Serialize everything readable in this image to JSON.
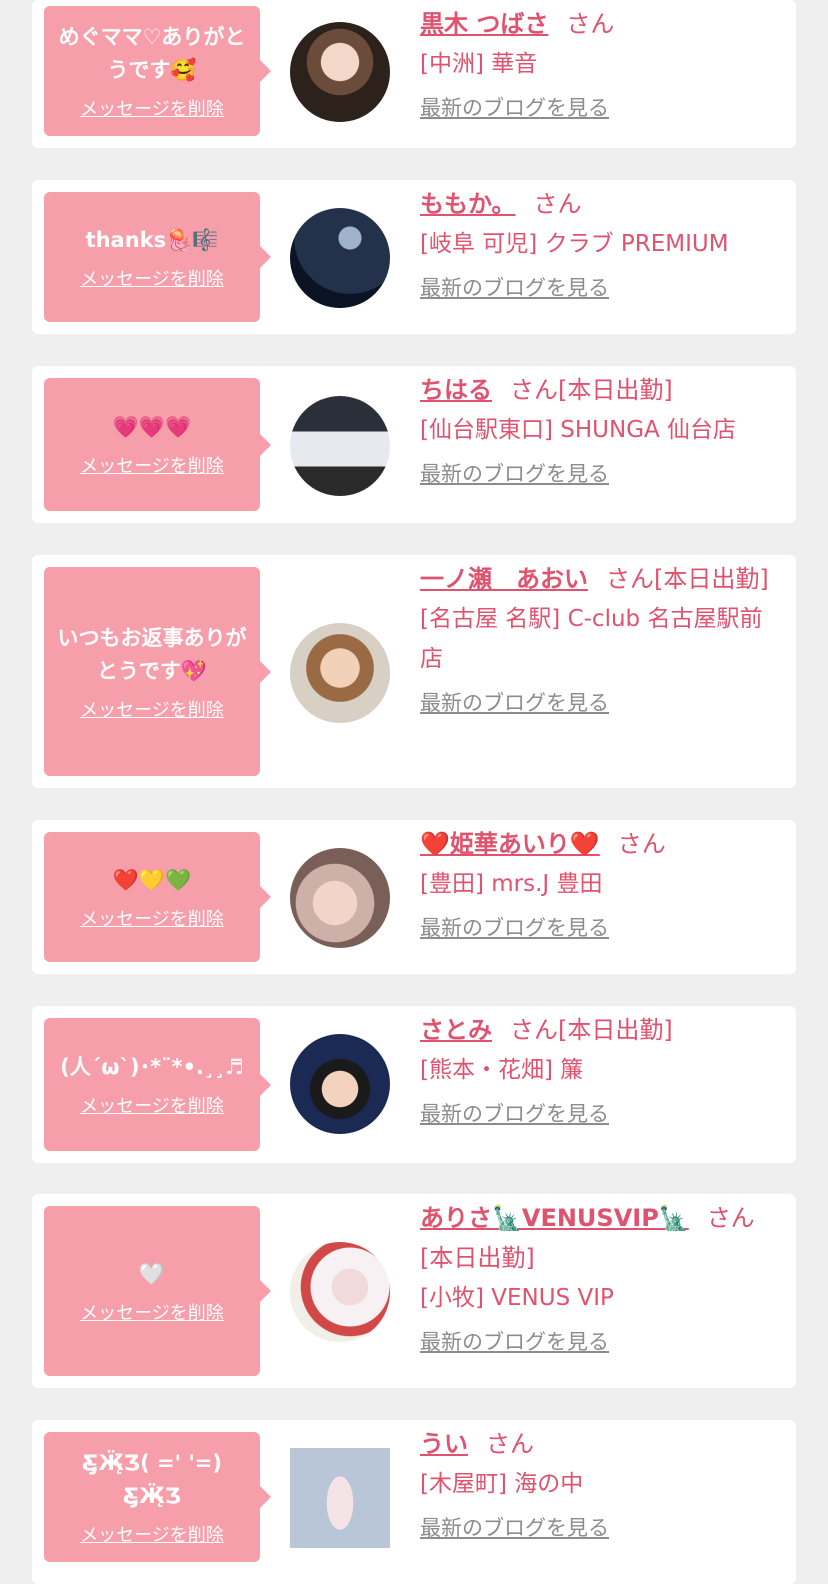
{
  "common": {
    "delete_label": "メッセージを削除",
    "blog_label": "最新のブログを見る",
    "san": "さん"
  },
  "colors": {
    "accent": "#e0536e",
    "bubble": "#f79eab",
    "link_gray": "#8c8c8c",
    "background": "#efefef"
  },
  "cards": [
    {
      "message": "めぐママ♡ありがとうです🥰",
      "name": "黒木 つばさ",
      "status": "",
      "shop": "[中洲] 華音"
    },
    {
      "message": "thanks🪼🎼",
      "name": "ももか。",
      "status": "",
      "shop": "[岐阜 可児] クラブ PREMIUM"
    },
    {
      "message": "💗💗💗",
      "name": "ちはる",
      "status": "[本日出勤]",
      "shop": "[仙台駅東口] SHUNGA 仙台店"
    },
    {
      "message": "いつもお返事ありがとうです💖",
      "name": "一ノ瀬　あおい",
      "status": "[本日出勤]",
      "shop": "[名古屋 名駅] C-club 名古屋駅前店"
    },
    {
      "message": "❤️💛💚",
      "name": "❤️姫華あいり❤️",
      "status": "",
      "shop": "[豊田] mrs.J 豊田"
    },
    {
      "message": "(人´ω`)･*¨*•.¸¸♬",
      "name": "さとみ",
      "status": "[本日出勤]",
      "shop": "[熊本・花畑] 簾"
    },
    {
      "message": "🤍",
      "name": "ありさ🗽VENUSVIP🗽",
      "status": "[本日出勤]",
      "shop": "[小牧] VENUS VIP"
    },
    {
      "message": "Ƹ̵̡Ӝ̵̨̄Ʒ( ='  '=)Ƹ̵̡Ӝ̵̨̄Ʒ",
      "name": "うい",
      "status": "",
      "shop": "[木屋町] 海の中"
    }
  ]
}
